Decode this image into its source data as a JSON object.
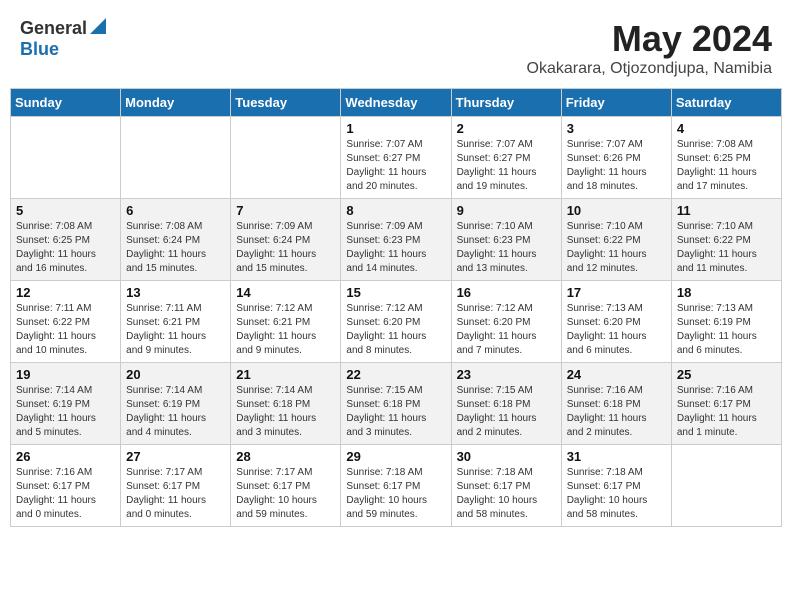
{
  "logo": {
    "general": "General",
    "blue": "Blue"
  },
  "title": {
    "month": "May 2024",
    "location": "Okakarara, Otjozondjupa, Namibia"
  },
  "days_of_week": [
    "Sunday",
    "Monday",
    "Tuesday",
    "Wednesday",
    "Thursday",
    "Friday",
    "Saturday"
  ],
  "weeks": [
    [
      {
        "day": "",
        "info": ""
      },
      {
        "day": "",
        "info": ""
      },
      {
        "day": "",
        "info": ""
      },
      {
        "day": "1",
        "info": "Sunrise: 7:07 AM\nSunset: 6:27 PM\nDaylight: 11 hours\nand 20 minutes."
      },
      {
        "day": "2",
        "info": "Sunrise: 7:07 AM\nSunset: 6:27 PM\nDaylight: 11 hours\nand 19 minutes."
      },
      {
        "day": "3",
        "info": "Sunrise: 7:07 AM\nSunset: 6:26 PM\nDaylight: 11 hours\nand 18 minutes."
      },
      {
        "day": "4",
        "info": "Sunrise: 7:08 AM\nSunset: 6:25 PM\nDaylight: 11 hours\nand 17 minutes."
      }
    ],
    [
      {
        "day": "5",
        "info": "Sunrise: 7:08 AM\nSunset: 6:25 PM\nDaylight: 11 hours\nand 16 minutes."
      },
      {
        "day": "6",
        "info": "Sunrise: 7:08 AM\nSunset: 6:24 PM\nDaylight: 11 hours\nand 15 minutes."
      },
      {
        "day": "7",
        "info": "Sunrise: 7:09 AM\nSunset: 6:24 PM\nDaylight: 11 hours\nand 15 minutes."
      },
      {
        "day": "8",
        "info": "Sunrise: 7:09 AM\nSunset: 6:23 PM\nDaylight: 11 hours\nand 14 minutes."
      },
      {
        "day": "9",
        "info": "Sunrise: 7:10 AM\nSunset: 6:23 PM\nDaylight: 11 hours\nand 13 minutes."
      },
      {
        "day": "10",
        "info": "Sunrise: 7:10 AM\nSunset: 6:22 PM\nDaylight: 11 hours\nand 12 minutes."
      },
      {
        "day": "11",
        "info": "Sunrise: 7:10 AM\nSunset: 6:22 PM\nDaylight: 11 hours\nand 11 minutes."
      }
    ],
    [
      {
        "day": "12",
        "info": "Sunrise: 7:11 AM\nSunset: 6:22 PM\nDaylight: 11 hours\nand 10 minutes."
      },
      {
        "day": "13",
        "info": "Sunrise: 7:11 AM\nSunset: 6:21 PM\nDaylight: 11 hours\nand 9 minutes."
      },
      {
        "day": "14",
        "info": "Sunrise: 7:12 AM\nSunset: 6:21 PM\nDaylight: 11 hours\nand 9 minutes."
      },
      {
        "day": "15",
        "info": "Sunrise: 7:12 AM\nSunset: 6:20 PM\nDaylight: 11 hours\nand 8 minutes."
      },
      {
        "day": "16",
        "info": "Sunrise: 7:12 AM\nSunset: 6:20 PM\nDaylight: 11 hours\nand 7 minutes."
      },
      {
        "day": "17",
        "info": "Sunrise: 7:13 AM\nSunset: 6:20 PM\nDaylight: 11 hours\nand 6 minutes."
      },
      {
        "day": "18",
        "info": "Sunrise: 7:13 AM\nSunset: 6:19 PM\nDaylight: 11 hours\nand 6 minutes."
      }
    ],
    [
      {
        "day": "19",
        "info": "Sunrise: 7:14 AM\nSunset: 6:19 PM\nDaylight: 11 hours\nand 5 minutes."
      },
      {
        "day": "20",
        "info": "Sunrise: 7:14 AM\nSunset: 6:19 PM\nDaylight: 11 hours\nand 4 minutes."
      },
      {
        "day": "21",
        "info": "Sunrise: 7:14 AM\nSunset: 6:18 PM\nDaylight: 11 hours\nand 3 minutes."
      },
      {
        "day": "22",
        "info": "Sunrise: 7:15 AM\nSunset: 6:18 PM\nDaylight: 11 hours\nand 3 minutes."
      },
      {
        "day": "23",
        "info": "Sunrise: 7:15 AM\nSunset: 6:18 PM\nDaylight: 11 hours\nand 2 minutes."
      },
      {
        "day": "24",
        "info": "Sunrise: 7:16 AM\nSunset: 6:18 PM\nDaylight: 11 hours\nand 2 minutes."
      },
      {
        "day": "25",
        "info": "Sunrise: 7:16 AM\nSunset: 6:17 PM\nDaylight: 11 hours\nand 1 minute."
      }
    ],
    [
      {
        "day": "26",
        "info": "Sunrise: 7:16 AM\nSunset: 6:17 PM\nDaylight: 11 hours\nand 0 minutes."
      },
      {
        "day": "27",
        "info": "Sunrise: 7:17 AM\nSunset: 6:17 PM\nDaylight: 11 hours\nand 0 minutes."
      },
      {
        "day": "28",
        "info": "Sunrise: 7:17 AM\nSunset: 6:17 PM\nDaylight: 10 hours\nand 59 minutes."
      },
      {
        "day": "29",
        "info": "Sunrise: 7:18 AM\nSunset: 6:17 PM\nDaylight: 10 hours\nand 59 minutes."
      },
      {
        "day": "30",
        "info": "Sunrise: 7:18 AM\nSunset: 6:17 PM\nDaylight: 10 hours\nand 58 minutes."
      },
      {
        "day": "31",
        "info": "Sunrise: 7:18 AM\nSunset: 6:17 PM\nDaylight: 10 hours\nand 58 minutes."
      },
      {
        "day": "",
        "info": ""
      }
    ]
  ]
}
